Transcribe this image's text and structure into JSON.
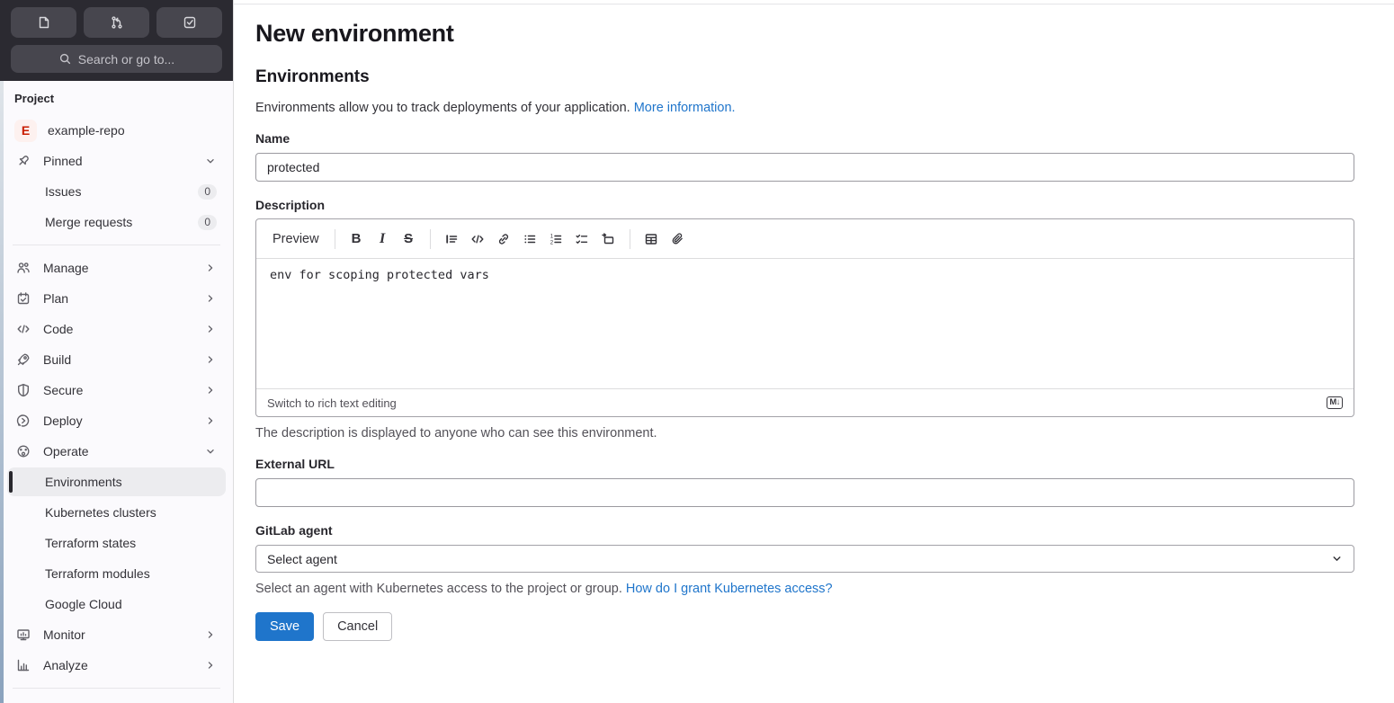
{
  "topbar": {
    "search_placeholder": "Search or go to..."
  },
  "sidebar": {
    "section_label": "Project",
    "project": {
      "initial": "E",
      "name": "example-repo"
    },
    "pinned_label": "Pinned",
    "pinned_items": [
      {
        "label": "Issues",
        "count": "0"
      },
      {
        "label": "Merge requests",
        "count": "0"
      }
    ],
    "menu": [
      {
        "label": "Manage"
      },
      {
        "label": "Plan"
      },
      {
        "label": "Code"
      },
      {
        "label": "Build"
      },
      {
        "label": "Secure"
      },
      {
        "label": "Deploy"
      },
      {
        "label": "Operate"
      }
    ],
    "operate_children": [
      {
        "label": "Environments"
      },
      {
        "label": "Kubernetes clusters"
      },
      {
        "label": "Terraform states"
      },
      {
        "label": "Terraform modules"
      },
      {
        "label": "Google Cloud"
      }
    ],
    "menu_bottom": [
      {
        "label": "Monitor"
      },
      {
        "label": "Analyze"
      }
    ]
  },
  "main": {
    "title": "New environment",
    "section_heading": "Environments",
    "intro": {
      "text": "Environments allow you to track deployments of your application.",
      "link": "More information."
    },
    "name": {
      "label": "Name",
      "value": "protected"
    },
    "description": {
      "label": "Description",
      "preview_label": "Preview",
      "glyphs": {
        "bold": "B",
        "italic": "I",
        "strike": "S"
      },
      "value": "env for scoping protected vars",
      "footer_action": "Switch to rich text editing",
      "markdown_badge": "M↓",
      "help": "The description is displayed to anyone who can see this environment."
    },
    "external_url": {
      "label": "External URL",
      "value": ""
    },
    "agent": {
      "label": "GitLab agent",
      "selected": "Select agent",
      "help_text": "Select an agent with Kubernetes access to the project or group.",
      "help_link": "How do I grant Kubernetes access?"
    },
    "actions": {
      "save": "Save",
      "cancel": "Cancel"
    }
  },
  "colors": {
    "accent_blue": "#1f75cb",
    "topbar_bg": "#2b2a31",
    "topbar_button_bg": "#47464e",
    "sidebar_bg": "#fbfafd",
    "active_item_bg": "#ececef",
    "active_indicator": "#28272d",
    "avatar_bg": "#fdf1ef",
    "avatar_text": "#c91c00"
  }
}
